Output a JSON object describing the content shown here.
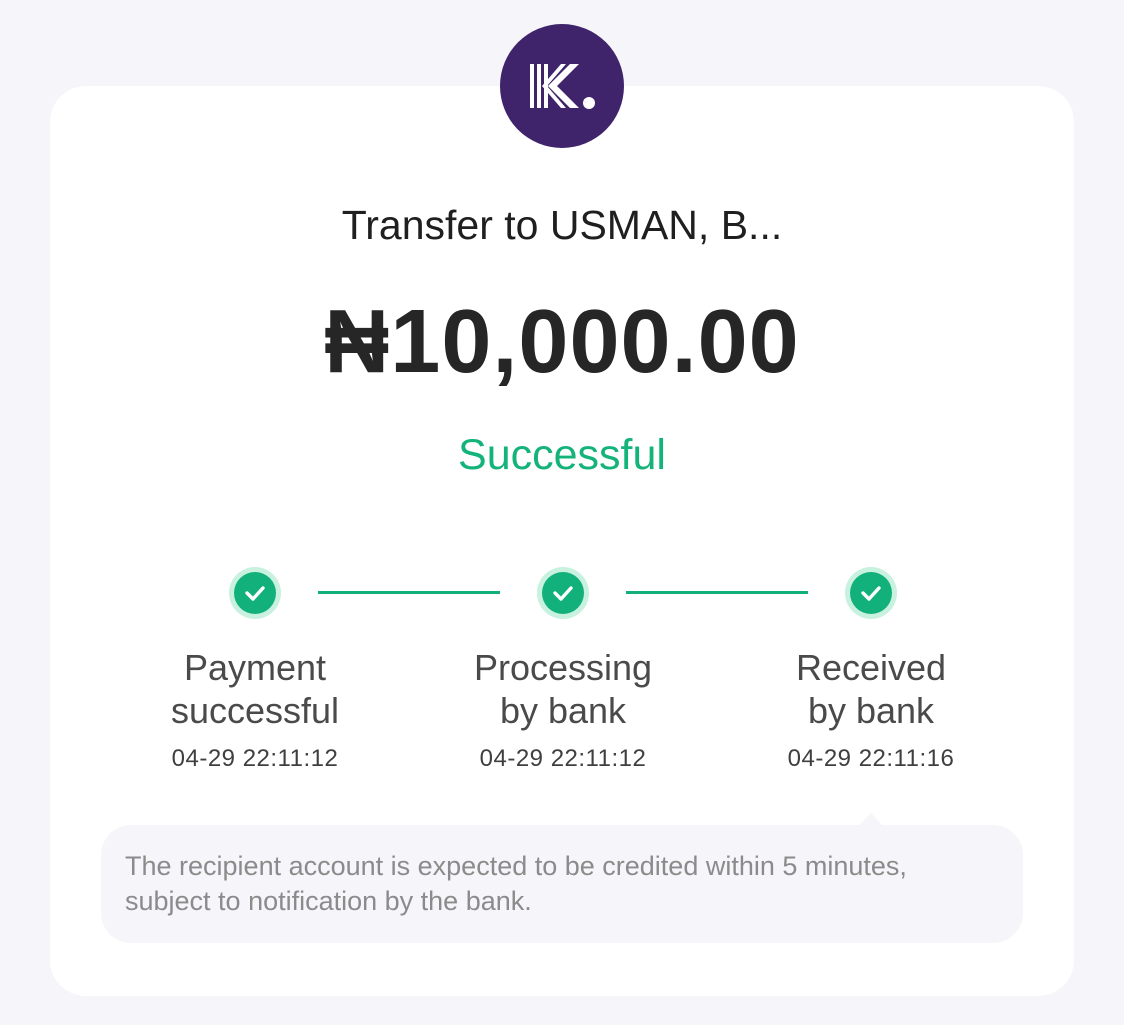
{
  "header": {
    "logo_icon": "kuda-k-logo",
    "logo_color": "#40246b"
  },
  "transfer": {
    "title": "Transfer to USMAN, B...",
    "amount": "₦10,000.00",
    "status": "Successful",
    "status_color": "#13b37a"
  },
  "steps": [
    {
      "label_line1": "Payment",
      "label_line2": "successful",
      "time": "04-29 22:11:12",
      "icon": "check-circle-icon"
    },
    {
      "label_line1": "Processing",
      "label_line2": "by bank",
      "time": "04-29 22:11:12",
      "icon": "check-circle-icon"
    },
    {
      "label_line1": "Received",
      "label_line2": "by bank",
      "time": "04-29 22:11:16",
      "icon": "check-circle-icon"
    }
  ],
  "note": {
    "text": "The recipient account is expected to be credited within 5 minutes, subject to notification by the bank."
  }
}
